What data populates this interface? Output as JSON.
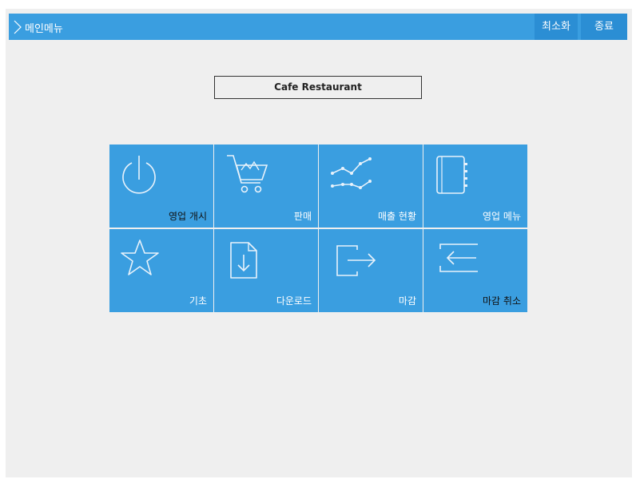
{
  "titlebar": {
    "title": "메인메뉴",
    "minimize_label": "최소화",
    "exit_label": "종료"
  },
  "store_name": "Cafe Restaurant",
  "tiles": [
    {
      "label": "영업 개시",
      "icon": "power-icon"
    },
    {
      "label": "판매",
      "icon": "shopping-cart-icon"
    },
    {
      "label": "매출 현황",
      "icon": "line-chart-icon"
    },
    {
      "label": "영업 메뉴",
      "icon": "notebook-icon"
    },
    {
      "label": "기초",
      "icon": "star-icon"
    },
    {
      "label": "다운로드",
      "icon": "download-file-icon"
    },
    {
      "label": "마감",
      "icon": "exit-arrow-icon"
    },
    {
      "label": "마감 취소",
      "icon": "enter-arrow-icon"
    }
  ],
  "colors": {
    "accent": "#3a9ee0",
    "titlebar_button": "#2b8ed4",
    "background": "#efefef"
  }
}
